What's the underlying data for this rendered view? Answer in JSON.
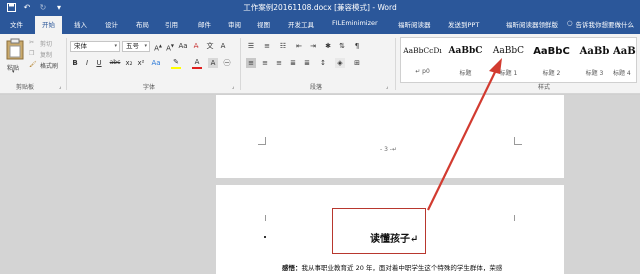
{
  "titlebar": {
    "title": "工作案例20161108.docx [兼容模式] - Word",
    "icons": [
      "save-icon",
      "undo-icon",
      "redo-icon",
      "customize-icon"
    ]
  },
  "tabs": [
    {
      "label": "文件"
    },
    {
      "label": "开始",
      "active": true
    },
    {
      "label": "插入"
    },
    {
      "label": "设计"
    },
    {
      "label": "布局"
    },
    {
      "label": "引用"
    },
    {
      "label": "邮件"
    },
    {
      "label": "审阅"
    },
    {
      "label": "视图"
    },
    {
      "label": "开发工具"
    },
    {
      "label": "FILEminimizer"
    },
    {
      "label": "福昕阅读器"
    },
    {
      "label": "发送到PPT"
    },
    {
      "label": "福昕阅读器领鲜版"
    }
  ],
  "tellme": "告诉我你想要做什么",
  "clipboard": {
    "paste": "粘贴",
    "cut": "剪切",
    "copy": "复制",
    "format_painter": "格式刷",
    "group": "剪贴板"
  },
  "font": {
    "name": "宋体",
    "size": "五号",
    "group": "字体",
    "buttons": [
      "B",
      "I",
      "U",
      "abc",
      "x₂",
      "x²",
      "Aa",
      "A",
      "A"
    ],
    "colors": {
      "highlight": "#ffff00",
      "font_color": "#e02020"
    }
  },
  "paragraph": {
    "group": "段落"
  },
  "styles": {
    "group": "样式",
    "items": [
      {
        "sample": "AaBbCcDı",
        "name": "↵ p0"
      },
      {
        "sample": "AaBbC",
        "name": "标题"
      },
      {
        "sample": "AaBbC",
        "name": "标题 1"
      },
      {
        "sample": "AaBbC",
        "name": "标题 2"
      },
      {
        "sample": "AaBb",
        "name": "标题 3"
      },
      {
        "sample": "AaB",
        "name": "标题 4"
      }
    ]
  },
  "document": {
    "page_number": "- 3 -↵",
    "title": "读懂孩子↵",
    "body_label": "感悟：",
    "body_text": "我从事职业教育近 20 年，面对着中职学生这个特殊的学生群体，荣感"
  },
  "colors": {
    "accent": "#2b579a",
    "annotation": "#b8372e"
  }
}
